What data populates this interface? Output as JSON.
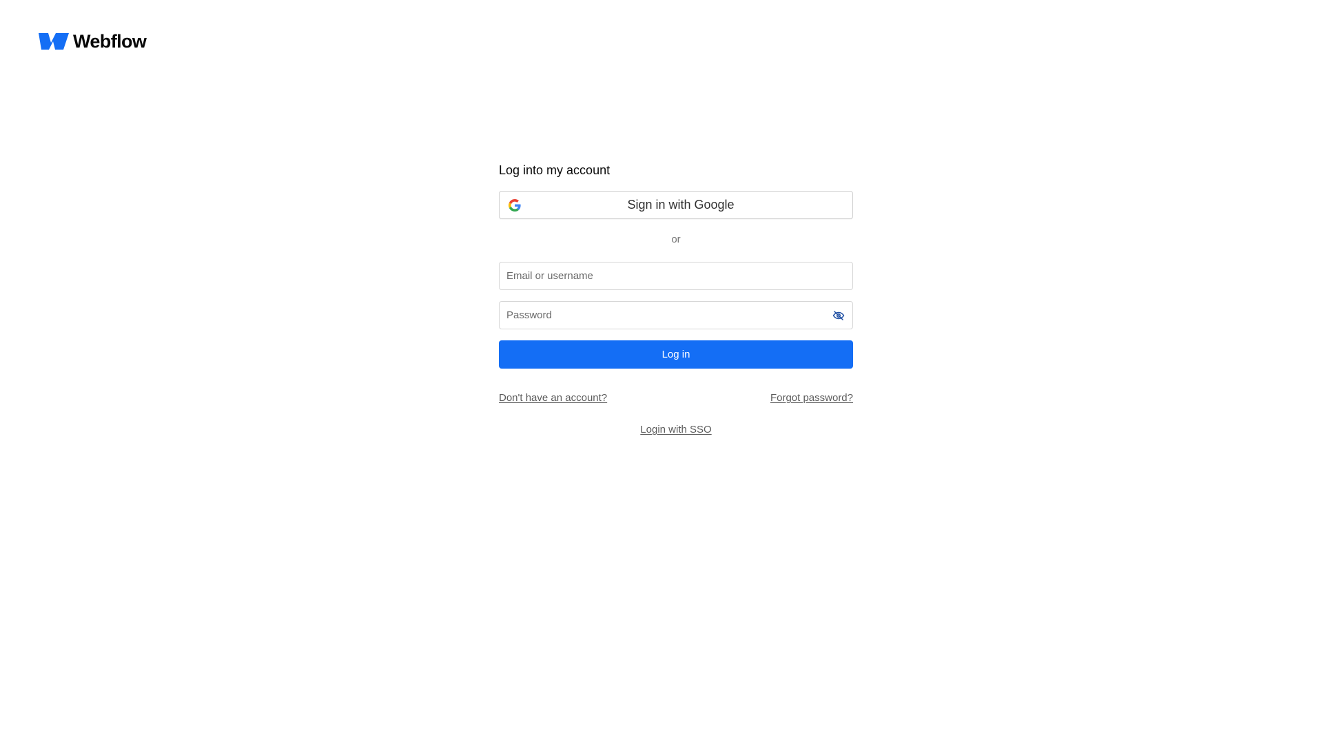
{
  "brand": {
    "name": "Webflow",
    "logo_icon": "webflow-w-icon",
    "color": "#146EF5"
  },
  "login": {
    "heading": "Log into my account",
    "google_button_label": "Sign in with Google",
    "google_icon": "google-g-icon",
    "divider_text": "or",
    "email_placeholder": "Email or username",
    "email_value": "",
    "password_placeholder": "Password",
    "password_value": "",
    "password_toggle_icon": "eye-slash-icon",
    "submit_label": "Log in",
    "submit_color": "#146EF5"
  },
  "links": {
    "signup": "Don't have an account?",
    "forgot_password": "Forgot password?",
    "sso": "Login with SSO"
  }
}
